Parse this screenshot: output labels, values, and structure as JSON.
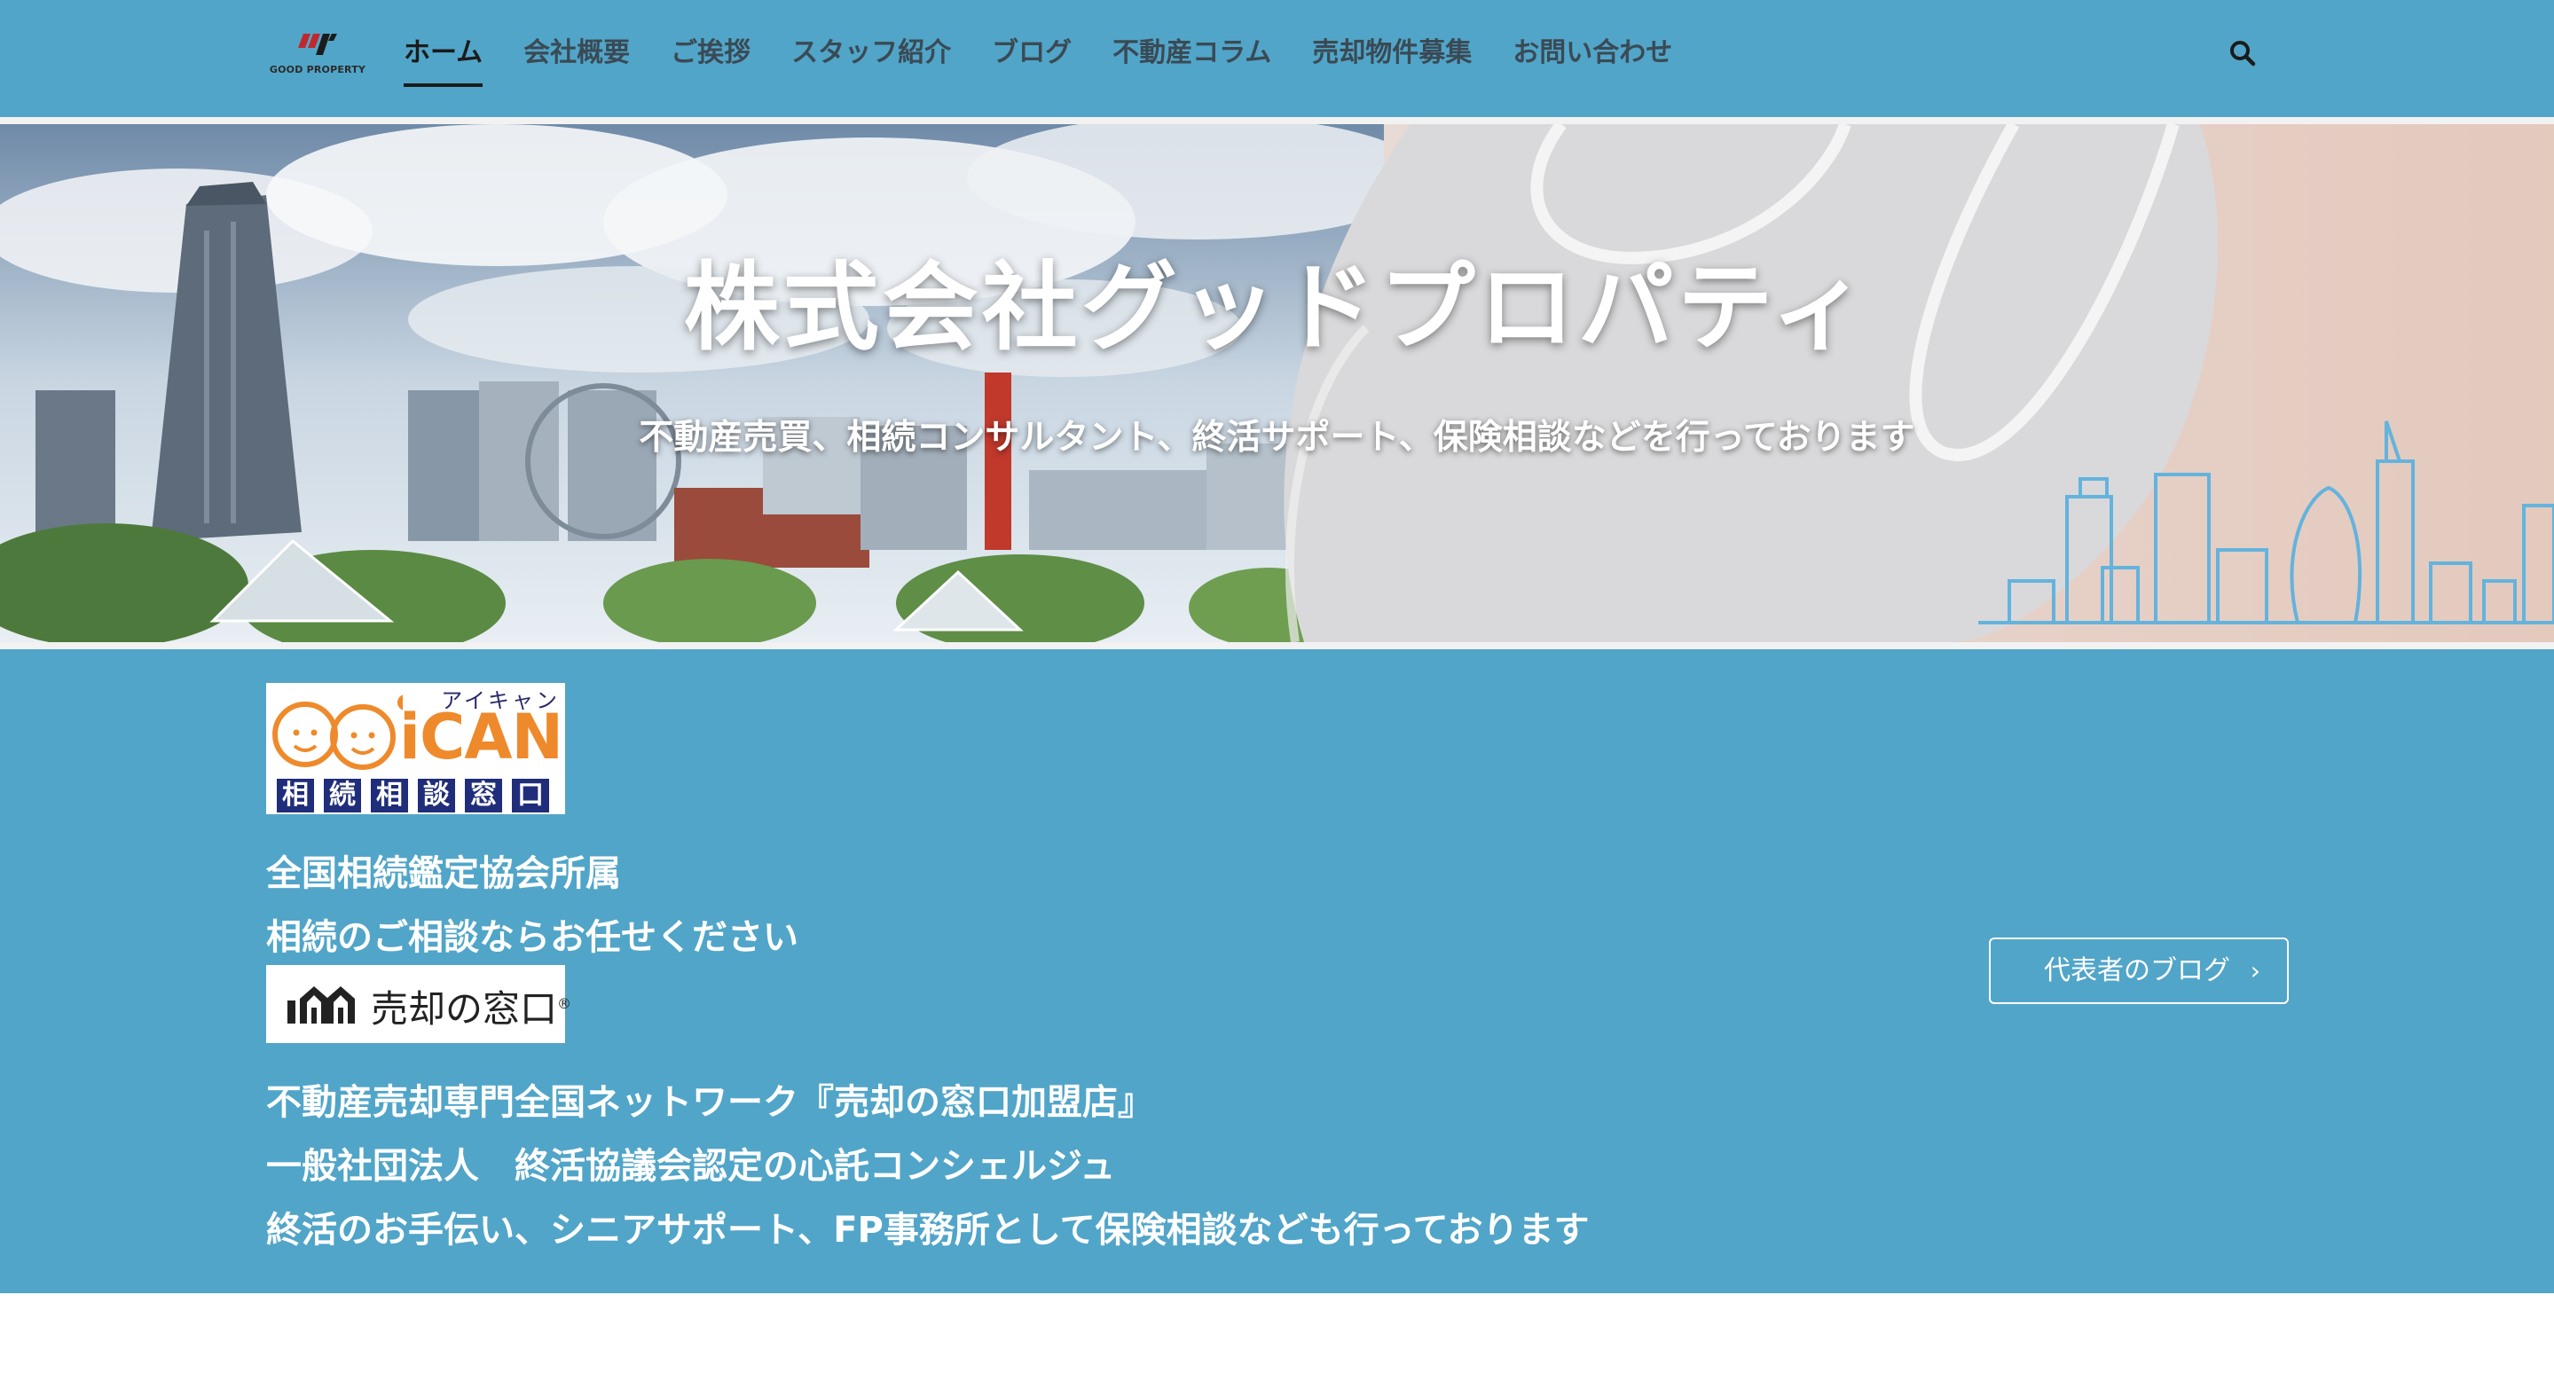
{
  "nav": {
    "logo_caption": "GOOD PROPERTY",
    "items": [
      {
        "label": "ホーム",
        "active": true
      },
      {
        "label": "会社概要"
      },
      {
        "label": "ご挨拶"
      },
      {
        "label": "スタッフ紹介"
      },
      {
        "label": "ブログ"
      },
      {
        "label": "不動産コラム"
      },
      {
        "label": "売却物件募集"
      },
      {
        "label": "お問い合わせ"
      }
    ],
    "search_icon": "search-icon"
  },
  "hero": {
    "title": "株式会社グッドプロパティ",
    "subtitle": "不動産売買、相続コンサルタント、終活サポート、保険相談などを行っております"
  },
  "info": {
    "ican_logo": {
      "kana": "アイキャン",
      "word": "iCAN",
      "boxes": [
        "相",
        "続",
        "相",
        "談",
        "窓",
        "口"
      ]
    },
    "line1": "全国相続鑑定協会所属",
    "line2": "相続のご相談ならお任せください",
    "baikyaku_logo": {
      "text": "売却の窓口",
      "mark": "®"
    },
    "line3": "不動産売却専門全国ネットワーク『売却の窓口加盟店』",
    "line4": "一般社団法人　終活協議会認定の心託コンシェルジュ",
    "line5": "終活のお手伝い、シニアサポート、FP事務所として保険相談なども行っております",
    "blog_button": {
      "label": "代表者のブログ",
      "icon": "chevron-right-icon"
    }
  },
  "colors": {
    "nav_bg": "#51a5c8",
    "info_bg": "#51a5c8",
    "ican_orange": "#ee8a2b",
    "ican_navy": "#1f2d7a"
  }
}
